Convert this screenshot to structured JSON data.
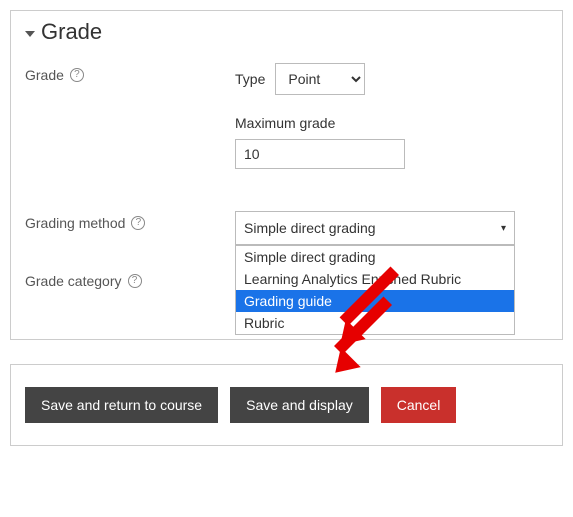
{
  "section_title": "Grade",
  "grade": {
    "label": "Grade",
    "type_label": "Type",
    "type_selected": "Point",
    "max_label": "Maximum grade",
    "max_value": "10"
  },
  "grading_method": {
    "label": "Grading method",
    "selected": "Simple direct grading",
    "options": [
      "Simple direct grading",
      "Learning Analytics Enriched Rubric",
      "Grading guide",
      "Rubric"
    ],
    "highlighted_index": 2
  },
  "grade_category": {
    "label": "Grade category"
  },
  "actions": {
    "save_return": "Save and return to course",
    "save_display": "Save and display",
    "cancel": "Cancel"
  },
  "help_glyph": "?"
}
